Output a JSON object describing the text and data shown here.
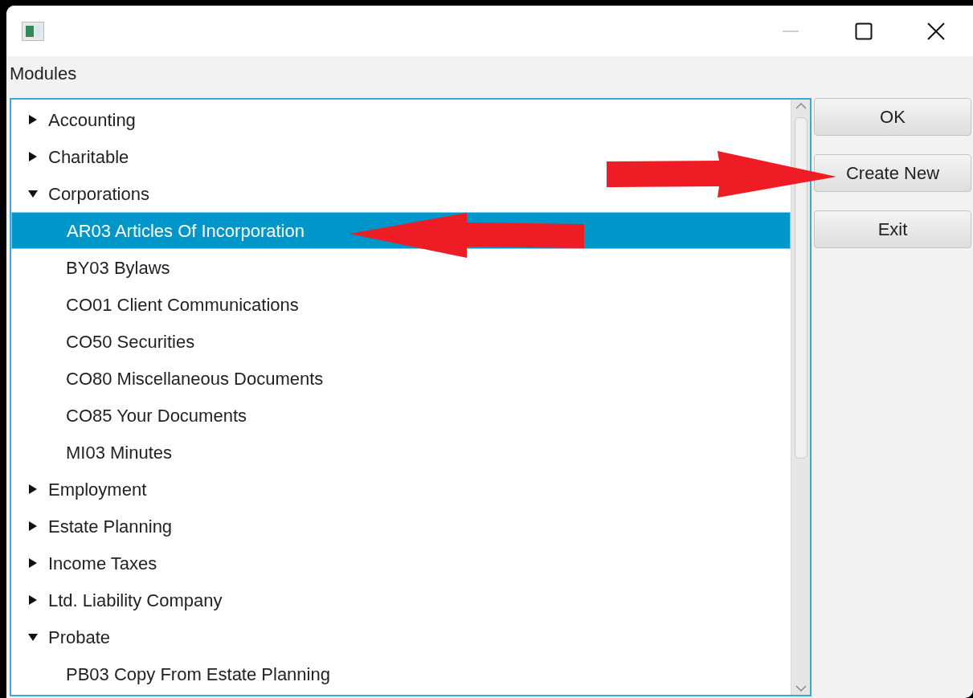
{
  "window": {
    "minimize_disabled": true
  },
  "label": "Modules",
  "tree": [
    {
      "label": "Accounting",
      "expanded": false,
      "selected": false
    },
    {
      "label": "Charitable",
      "expanded": false,
      "selected": false
    },
    {
      "label": "Corporations",
      "expanded": true,
      "selected": false,
      "children": [
        {
          "label": "AR03 Articles Of Incorporation",
          "selected": true
        },
        {
          "label": "BY03 Bylaws",
          "selected": false
        },
        {
          "label": "CO01 Client Communications",
          "selected": false
        },
        {
          "label": "CO50 Securities",
          "selected": false
        },
        {
          "label": "CO80 Miscellaneous Documents",
          "selected": false
        },
        {
          "label": "CO85 Your Documents",
          "selected": false
        },
        {
          "label": "MI03 Minutes",
          "selected": false
        }
      ]
    },
    {
      "label": "Employment",
      "expanded": false,
      "selected": false
    },
    {
      "label": "Estate Planning",
      "expanded": false,
      "selected": false
    },
    {
      "label": "Income Taxes",
      "expanded": false,
      "selected": false
    },
    {
      "label": "Ltd. Liability Company",
      "expanded": false,
      "selected": false
    },
    {
      "label": "Probate",
      "expanded": true,
      "selected": false,
      "children": [
        {
          "label": "PB03 Copy From Estate Planning",
          "selected": false
        }
      ]
    }
  ],
  "buttons": [
    "OK",
    "Create New",
    "Exit"
  ]
}
